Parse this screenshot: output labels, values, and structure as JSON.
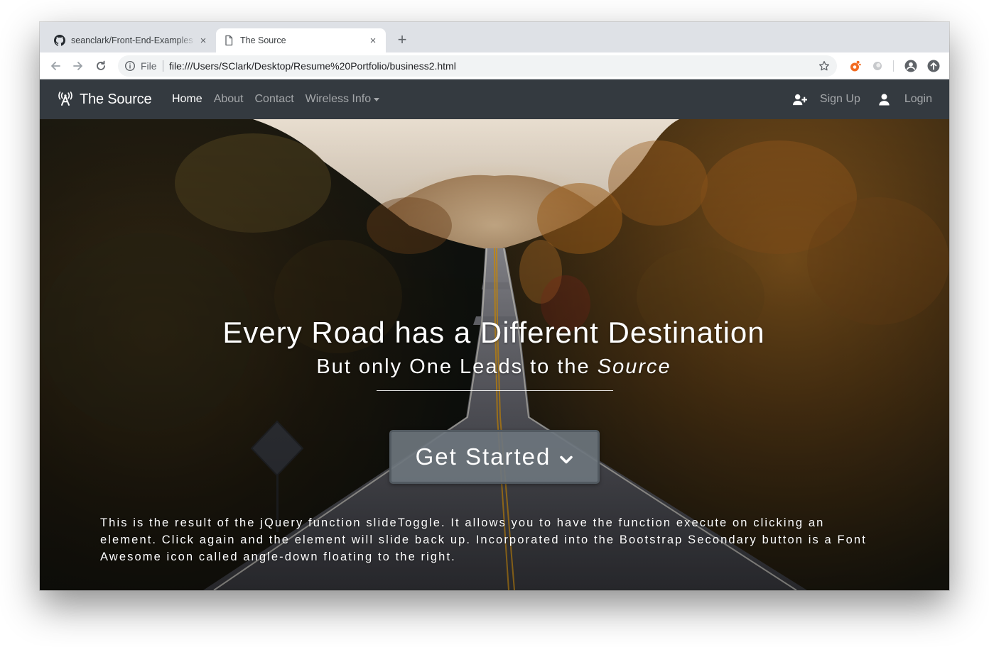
{
  "browser": {
    "tabs": [
      {
        "title": "seanclark/Front-End-Examples",
        "favicon": "github-icon",
        "active": false
      },
      {
        "title": "The Source",
        "favicon": "page-icon",
        "active": true
      }
    ],
    "new_tab_label": "+",
    "close_glyph": "×",
    "omnibox": {
      "scheme_label": "File",
      "url": "file:///Users/SClark/Desktop/Resume%20Portfolio/business2.html"
    }
  },
  "navbar": {
    "brand": "The Source",
    "links": [
      {
        "label": "Home",
        "active": true
      },
      {
        "label": "About",
        "active": false
      },
      {
        "label": "Contact",
        "active": false
      },
      {
        "label": "Wireless Info",
        "active": false,
        "dropdown": true
      }
    ],
    "signup_label": "Sign Up",
    "login_label": "Login"
  },
  "hero": {
    "title": "Every Road has a Different Destination",
    "subtitle_prefix": "But only One Leads to the ",
    "subtitle_emphasis": "Source",
    "cta_label": "Get Started",
    "description": "This is the result of the jQuery function slideToggle. It allows you to have the function execute on clicking an element. Click again and the element will slide back up. Incorporated into the Bootstrap Secondary button is a Font Awesome icon called angle-down floating to the right."
  },
  "colors": {
    "navbar_bg": "#343a40",
    "cta_bg": "#6c757d",
    "tabstrip_bg": "#dee1e6"
  },
  "icons": {
    "brand": "broadcast-tower-icon",
    "signup": "user-plus-icon",
    "login": "user-icon",
    "cta": "angle-down-icon"
  }
}
